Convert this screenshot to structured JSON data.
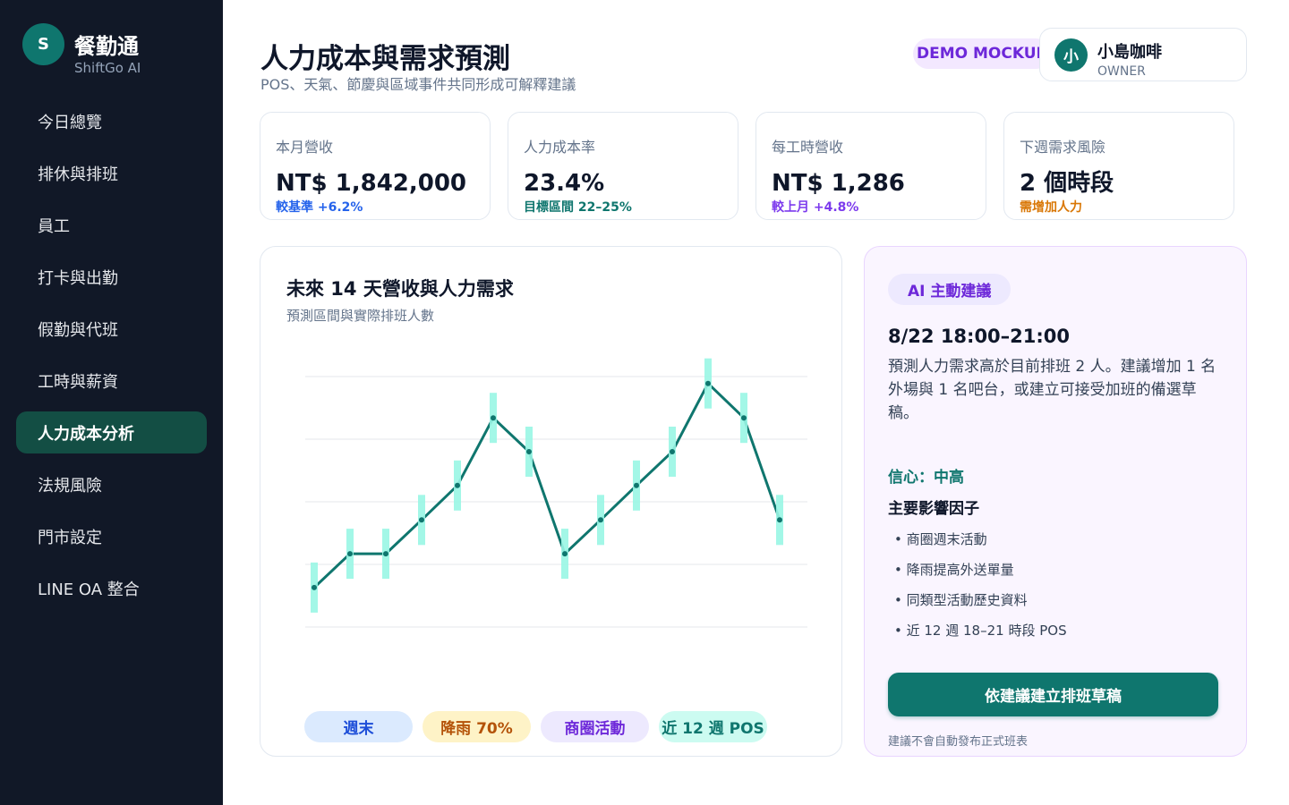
{
  "brand": {
    "logo_letter": "S",
    "name": "餐勤通",
    "sub": "ShiftGo AI"
  },
  "nav": [
    {
      "label": "今日總覽"
    },
    {
      "label": "排休與排班"
    },
    {
      "label": "員工"
    },
    {
      "label": "打卡與出勤"
    },
    {
      "label": "假勤與代班"
    },
    {
      "label": "工時與薪資"
    },
    {
      "label": "人力成本分析",
      "active": true
    },
    {
      "label": "法規風險"
    },
    {
      "label": "門市設定"
    },
    {
      "label": "LINE OA 整合"
    }
  ],
  "header": {
    "title": "人力成本與需求預測",
    "subtitle": "POS、天氣、節慶與區域事件共同形成可解釋建議",
    "demo_badge": "DEMO MOCKUP",
    "user": {
      "avatar": "小",
      "name": "小島咖啡",
      "role": "OWNER"
    }
  },
  "kpis": [
    {
      "label": "本月營收",
      "value": "NT$ 1,842,000",
      "delta": "較基準 +6.2%",
      "color": "#2563eb"
    },
    {
      "label": "人力成本率",
      "value": "23.4%",
      "delta": "目標區間 22–25%",
      "color": "#0f766e"
    },
    {
      "label": "每工時營收",
      "value": "NT$ 1,286",
      "delta": "較上月 +4.8%",
      "color": "#7c3aed"
    },
    {
      "label": "下週需求風險",
      "value": "2 個時段",
      "delta": "需增加人力",
      "color": "#d97706"
    }
  ],
  "chart": {
    "title": "未來 14 天營收與人力需求",
    "subtitle": "預測區間與實際排班人數",
    "chips": [
      {
        "label": "週末",
        "bg": "#dbeafe",
        "fg": "#1d4ed8"
      },
      {
        "label": "降雨 70%",
        "bg": "#fef3c7",
        "fg": "#b45309"
      },
      {
        "label": "商圈活動",
        "bg": "#ede9fe",
        "fg": "#6d28d9"
      },
      {
        "label": "近 12 週 POS",
        "bg": "#ccfbf1",
        "fg": "#0f766e"
      }
    ]
  },
  "chart_data": {
    "type": "line",
    "title": "未來 14 天營收與人力需求",
    "subtitle": "預測區間與實際排班人數",
    "x": [
      1,
      2,
      3,
      4,
      5,
      6,
      7,
      8,
      9,
      10,
      11,
      12,
      13,
      14
    ],
    "series": [
      {
        "values": [
          0.63,
          1.17,
          1.17,
          1.71,
          2.26,
          3.34,
          2.8,
          1.17,
          1.71,
          2.26,
          2.8,
          3.89,
          3.34,
          1.71
        ]
      }
    ],
    "interval_halfwidth": [
      0.4,
      0.4,
      0.4,
      0.4,
      0.4,
      0.4,
      0.4,
      0.4,
      0.4,
      0.4,
      0.4,
      0.4,
      0.4,
      0.4
    ],
    "ylim": [
      0,
      4
    ],
    "grid": true,
    "colors": {
      "line": "#0f766e",
      "band": "#99f6e4"
    }
  },
  "ai": {
    "badge": "AI 主動建議",
    "time": "8/22 18:00–21:00",
    "desc": "預測人力需求高於目前排班 2 人。建議增加 1 名外場與 1 名吧台，或建立可接受加班的備選草稿。",
    "confidence": "信心：中高",
    "factors_title": "主要影響因子",
    "factors": [
      "• 商圈週末活動",
      "• 降雨提高外送單量",
      "• 同類型活動歷史資料",
      "• 近 12 週 18–21 時段 POS"
    ],
    "button": "依建議建立排班草稿",
    "note": "建議不會自動發布正式班表"
  }
}
